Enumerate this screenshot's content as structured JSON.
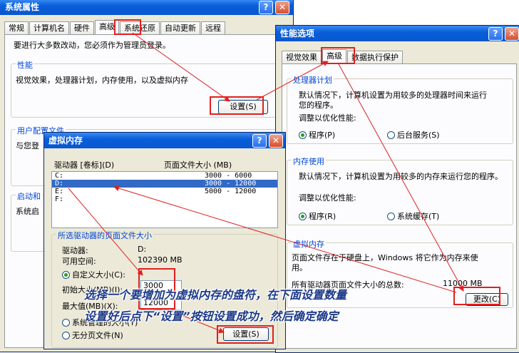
{
  "sysprops": {
    "title": "系统属性",
    "help_btn": "?",
    "close_btn": "✕",
    "tabs": [
      "常规",
      "计算机名",
      "硬件",
      "高级",
      "系统还原",
      "自动更新",
      "远程"
    ],
    "admin_note": "要进行大多数改动，您必须作为管理员登录。",
    "perf_group": "性能",
    "perf_desc": "视觉效果，处理器计划，内存使用，以及虚拟内存",
    "settings_btn": "设置(S)",
    "profile_group": "用户配置文件",
    "profile_desc": "与您登",
    "startup_group": "启动和",
    "startup_desc": "系统启"
  },
  "perfopts": {
    "title": "性能选项",
    "help_btn": "?",
    "close_btn": "✕",
    "tabs": [
      "视觉效果",
      "高级",
      "数据执行保护"
    ],
    "cpu_group": "处理器计划",
    "cpu_desc1": "默认情况下，计算机设置为用较多的处理器时间来运行",
    "cpu_desc2": "您的程序。",
    "cpu_adjust": "调整以优化性能:",
    "cpu_opt1": "程序(P)",
    "cpu_opt2": "后台服务(S)",
    "mem_group": "内存使用",
    "mem_desc": "默认情况下，计算机设置为用较多的内存来运行您的程序。",
    "mem_adjust": "调整以优化性能:",
    "mem_opt1": "程序(R)",
    "mem_opt2": "系统缓存(T)",
    "vm_group": "虚拟内存",
    "vm_desc1": "页面文件存在于硬盘上，Windows 将它作为内存来使",
    "vm_desc2": "用。",
    "vm_total_label": "所有驱动器页面文件大小的总数:",
    "vm_total_value": "11000 MB",
    "change_btn": "更改(C)"
  },
  "vmem": {
    "title": "虚拟内存",
    "help_btn": "?",
    "close_btn": "✕",
    "col_drive": "驱动器 [卷标](D)",
    "col_size": "页面文件大小 (MB)",
    "drives": [
      {
        "drive": "C:",
        "size": "3000 - 6000"
      },
      {
        "drive": "D:",
        "size": "3000 - 12000"
      },
      {
        "drive": "E:",
        "size": "5000 - 12000"
      },
      {
        "drive": "F:",
        "size": ""
      }
    ],
    "selected_group": "所选驱动器的页面文件大小",
    "drive_label": "驱动器:",
    "drive_value": "D:",
    "space_label": "可用空间:",
    "space_value": "102390 MB",
    "custom_label": "自定义大小(C):",
    "initial_label": "初始大小(MB)(I):",
    "initial_value": "3000",
    "max_label": "最大值(MB)(X):",
    "max_value": "12000",
    "system_label": "系统管理的大小(Y)",
    "none_label": "无分页文件(N)",
    "set_btn": "设置(S)"
  },
  "annotation": {
    "line1": "选择一个要增加为虚拟内存的盘符，在下面设置数量",
    "line2": "设置好后点下“设置”按钮设置成功，然后确定确定"
  },
  "colors": {
    "title_bar": "#0757d0",
    "annotation_red": "#e02020",
    "select": "#316ac5"
  }
}
